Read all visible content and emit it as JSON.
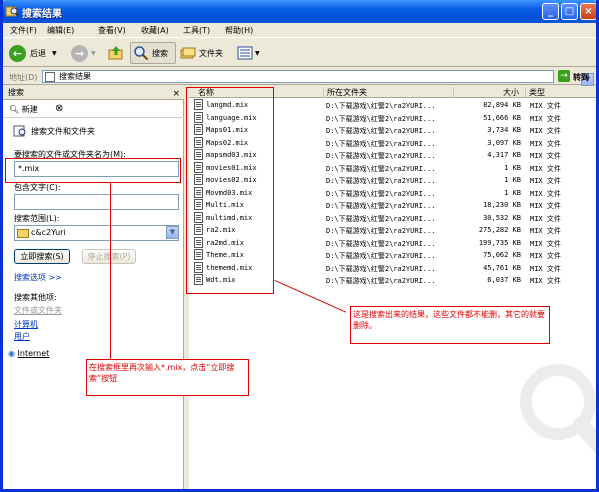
{
  "window": {
    "title": "搜索结果",
    "min": "_",
    "max": "□",
    "close": "×"
  },
  "menu": [
    "文件(F)",
    "编辑(E)",
    "查看(V)",
    "收藏(A)",
    "工具(T)",
    "帮助(H)"
  ],
  "toolbar": {
    "back": "后退",
    "search": "搜索",
    "folders": "文件夹"
  },
  "address": {
    "label": "地址(D)",
    "value": "搜索结果",
    "go": "转到"
  },
  "search_pane": {
    "header": "搜索",
    "new_label": "新建",
    "section_title": "搜索文件和文件夹",
    "name_label": "要搜索的文件或文件夹名为(M):",
    "name_value": "*.mix",
    "contains_label": "包含文字(C):",
    "contains_value": "",
    "lookin_label": "搜索范围(L):",
    "lookin_value": "c&c2Yuri",
    "search_now": "立即搜索(S)",
    "stop": "停止搜索(P)",
    "options": "搜索选项 >>",
    "other_title": "搜索其他项:",
    "other_items": [
      "文件或文件夹",
      "计算机",
      "用户"
    ],
    "internet": "Internet"
  },
  "columns": {
    "name": "名称",
    "folder": "所在文件夹",
    "size": "大小",
    "type": "类型"
  },
  "files": [
    {
      "name": "langmd.mix",
      "folder": "D:\\下载游戏\\红警2\\ra2YURI...",
      "size": "82,894 KB",
      "type": "MIX 文件"
    },
    {
      "name": "language.mix",
      "folder": "D:\\下载游戏\\红警2\\ra2YURI...",
      "size": "51,666 KB",
      "type": "MIX 文件"
    },
    {
      "name": "Maps01.mix",
      "folder": "D:\\下载游戏\\红警2\\ra2YURI...",
      "size": "3,734 KB",
      "type": "MIX 文件"
    },
    {
      "name": "Maps02.mix",
      "folder": "D:\\下载游戏\\红警2\\ra2YURI...",
      "size": "3,097 KB",
      "type": "MIX 文件"
    },
    {
      "name": "mapsmd03.mix",
      "folder": "D:\\下载游戏\\红警2\\ra2YURI...",
      "size": "4,317 KB",
      "type": "MIX 文件"
    },
    {
      "name": "movies01.mix",
      "folder": "D:\\下载游戏\\红警2\\ra2YURI...",
      "size": "1 KB",
      "type": "MIX 文件"
    },
    {
      "name": "movies02.mix",
      "folder": "D:\\下载游戏\\红警2\\ra2YURI...",
      "size": "1 KB",
      "type": "MIX 文件"
    },
    {
      "name": "Movmd03.mix",
      "folder": "D:\\下载游戏\\红警2\\ra2YURI...",
      "size": "1 KB",
      "type": "MIX 文件"
    },
    {
      "name": "Multi.mix",
      "folder": "D:\\下载游戏\\红警2\\ra2YURI...",
      "size": "18,230 KB",
      "type": "MIX 文件"
    },
    {
      "name": "multimd.mix",
      "folder": "D:\\下载游戏\\红警2\\ra2YURI...",
      "size": "30,532 KB",
      "type": "MIX 文件"
    },
    {
      "name": "ra2.mix",
      "folder": "D:\\下载游戏\\红警2\\ra2YURI...",
      "size": "275,282 KB",
      "type": "MIX 文件"
    },
    {
      "name": "ra2md.mix",
      "folder": "D:\\下载游戏\\红警2\\ra2YURI...",
      "size": "199,735 KB",
      "type": "MIX 文件"
    },
    {
      "name": "Theme.mix",
      "folder": "D:\\下载游戏\\红警2\\ra2YURI...",
      "size": "75,062 KB",
      "type": "MIX 文件"
    },
    {
      "name": "thememd.mix",
      "folder": "D:\\下载游戏\\红警2\\ra2YURI...",
      "size": "45,761 KB",
      "type": "MIX 文件"
    },
    {
      "name": "Wdt.mix",
      "folder": "D:\\下载游戏\\红警2\\ra2YURI...",
      "size": "6,037 KB",
      "type": "MIX 文件"
    }
  ],
  "annotations": {
    "right_note": "这是搜索出来的结果，这些文件都不能删，其它的就要删除。",
    "left_note": "在搜索框里再次输入*.mix，点击“立即搜索”按钮"
  },
  "colors": {
    "title_blue": "#0a5fe8",
    "xp_face": "#ece9d8",
    "annotation_red": "#e00000"
  }
}
